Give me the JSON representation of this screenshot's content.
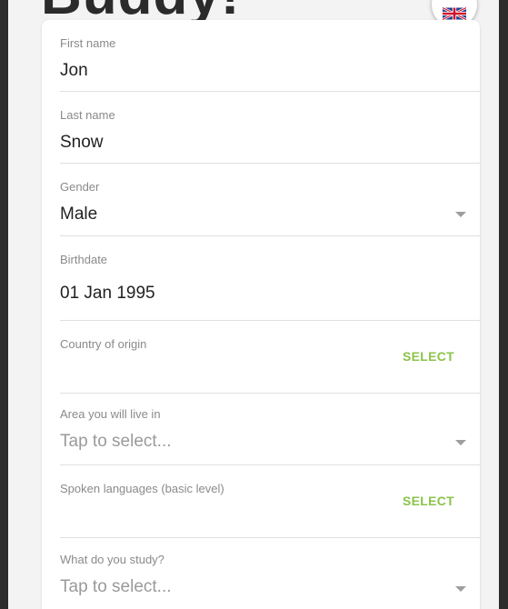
{
  "app": {
    "brand_text": "Buddy!"
  },
  "language_button": {
    "icon": "uk-flag-icon"
  },
  "form": {
    "first_name": {
      "label": "First name",
      "value": "Jon"
    },
    "last_name": {
      "label": "Last name",
      "value": "Snow"
    },
    "gender": {
      "label": "Gender",
      "value": "Male",
      "icon": "chevron-down-icon"
    },
    "birthdate": {
      "label": "Birthdate",
      "value": "01 Jan 1995"
    },
    "country": {
      "label": "Country of origin",
      "action": "SELECT"
    },
    "area": {
      "label": "Area you will live in",
      "placeholder": "Tap to select...",
      "icon": "chevron-down-icon"
    },
    "languages": {
      "label": "Spoken languages (basic level)",
      "action": "SELECT"
    },
    "study": {
      "label": "What do you study?",
      "placeholder": "Tap to select...",
      "icon": "chevron-down-icon"
    }
  },
  "colors": {
    "accent": "#8bc34a",
    "frame": "#2c2c2c",
    "label": "#8a8a8a",
    "text": "#222222",
    "placeholder": "#9a9a9a",
    "divider": "#e0e0e0"
  }
}
